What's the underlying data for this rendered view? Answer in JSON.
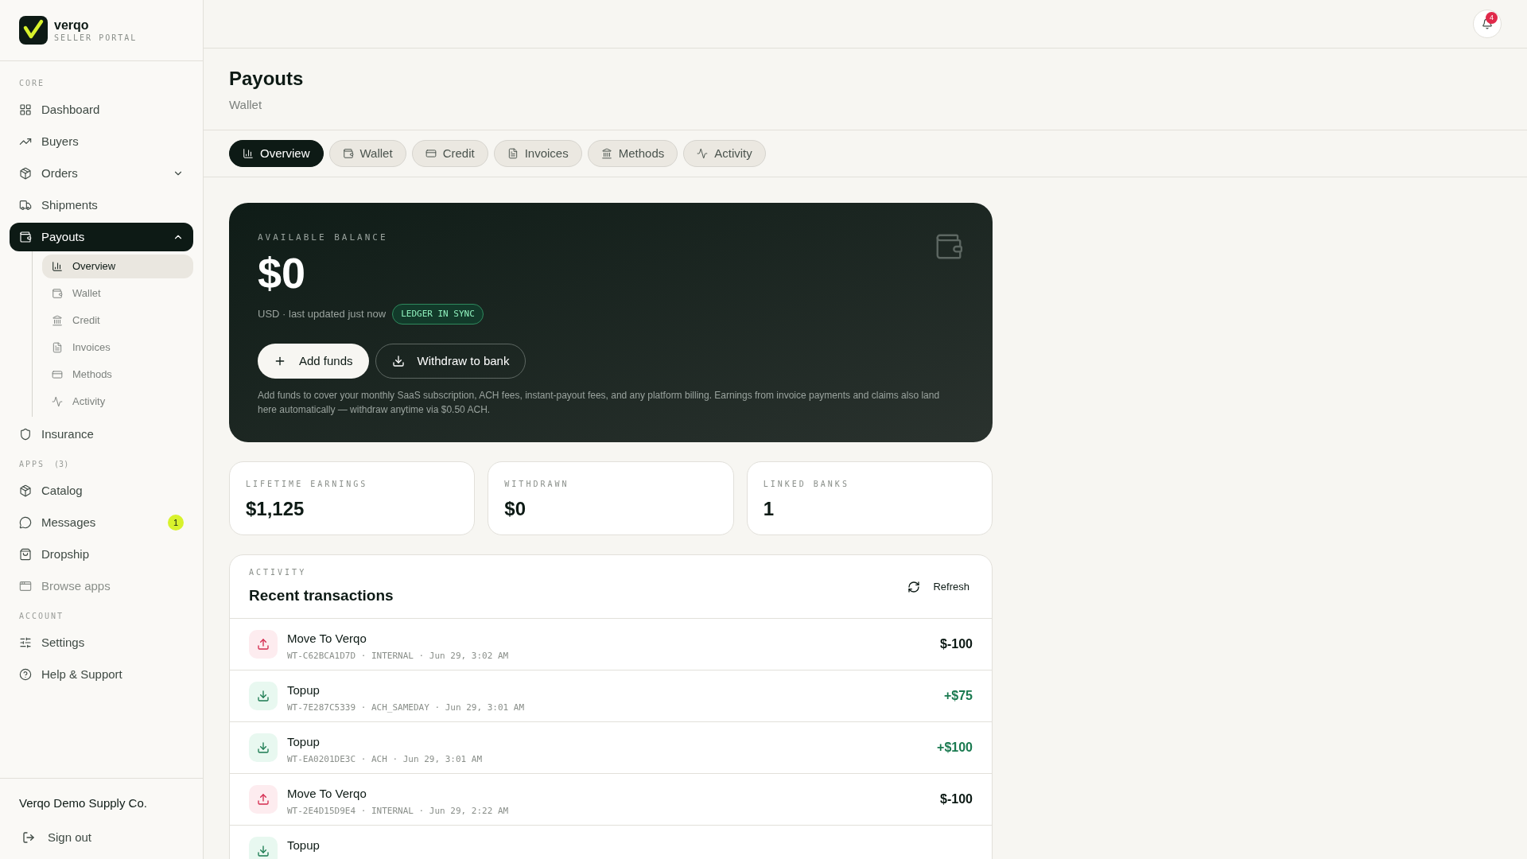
{
  "brand": {
    "name": "verqo",
    "tagline": "SELLER PORTAL"
  },
  "sidebar": {
    "sections": [
      {
        "heading": "CORE",
        "items": [
          {
            "label": "Dashboard",
            "selected": false
          },
          {
            "label": "Buyers",
            "selected": false
          },
          {
            "label": "Orders",
            "selected": false,
            "expanded": false
          },
          {
            "label": "Shipments",
            "selected": false
          },
          {
            "label": "Payouts",
            "selected": true,
            "expanded": true,
            "children": [
              {
                "label": "Overview",
                "selected": true
              },
              {
                "label": "Wallet",
                "selected": false
              },
              {
                "label": "Credit",
                "selected": false
              },
              {
                "label": "Invoices",
                "selected": false
              },
              {
                "label": "Methods",
                "selected": false
              },
              {
                "label": "Activity",
                "selected": false
              }
            ]
          },
          {
            "label": "Insurance",
            "selected": false
          }
        ]
      },
      {
        "heading": "APPS",
        "count": "(3)",
        "items": [
          {
            "label": "Catalog",
            "selected": false
          },
          {
            "label": "Messages",
            "selected": false,
            "badge": "1"
          },
          {
            "label": "Dropship",
            "selected": false
          },
          {
            "label": "Browse apps",
            "selected": false,
            "muted": true
          }
        ]
      },
      {
        "heading": "ACCOUNT",
        "items": [
          {
            "label": "Settings",
            "selected": false
          },
          {
            "label": "Help & Support",
            "selected": false
          }
        ]
      }
    ],
    "company": "Verqo Demo Supply Co.",
    "sign_out": "Sign out"
  },
  "header": {
    "notification_count": "4"
  },
  "page": {
    "title": "Payouts",
    "subtitle": "Wallet"
  },
  "tabs": [
    {
      "label": "Overview",
      "selected": true
    },
    {
      "label": "Wallet",
      "selected": false
    },
    {
      "label": "Credit",
      "selected": false
    },
    {
      "label": "Invoices",
      "selected": false
    },
    {
      "label": "Methods",
      "selected": false
    },
    {
      "label": "Activity",
      "selected": false
    }
  ],
  "balance": {
    "label": "AVAILABLE BALANCE",
    "amount": "$0",
    "meta": "USD · last updated just now",
    "status": "LEDGER IN SYNC",
    "add_button": "Add funds",
    "withdraw_button": "Withdraw to bank",
    "note": "Add funds to cover your monthly SaaS subscription, ACH fees, instant-payout fees, and any platform billing. Earnings from invoice payments and claims also land here automatically — withdraw anytime via $0.50 ACH."
  },
  "stats": [
    {
      "label": "LIFETIME EARNINGS",
      "value": "$1,125"
    },
    {
      "label": "WITHDRAWN",
      "value": "$0"
    },
    {
      "label": "LINKED BANKS",
      "value": "1"
    }
  ],
  "activity": {
    "eyebrow": "ACTIVITY",
    "title": "Recent transactions",
    "refresh": "Refresh",
    "rows": [
      {
        "kind": "out",
        "title": "Move To Verqo",
        "meta": "WT-C62BCA1D7D · INTERNAL · Jun 29, 3:02 AM",
        "amount": "$-100"
      },
      {
        "kind": "in",
        "title": "Topup",
        "meta": "WT-7E287C5339 · ACH_SAMEDAY · Jun 29, 3:01 AM",
        "amount": "+$75"
      },
      {
        "kind": "in",
        "title": "Topup",
        "meta": "WT-EA0201DE3C · ACH · Jun 29, 3:01 AM",
        "amount": "+$100"
      },
      {
        "kind": "out",
        "title": "Move To Verqo",
        "meta": "WT-2E4D15D9E4 · INTERNAL · Jun 29, 2:22 AM",
        "amount": "$-100"
      },
      {
        "kind": "in",
        "title": "Topup"
      }
    ]
  }
}
